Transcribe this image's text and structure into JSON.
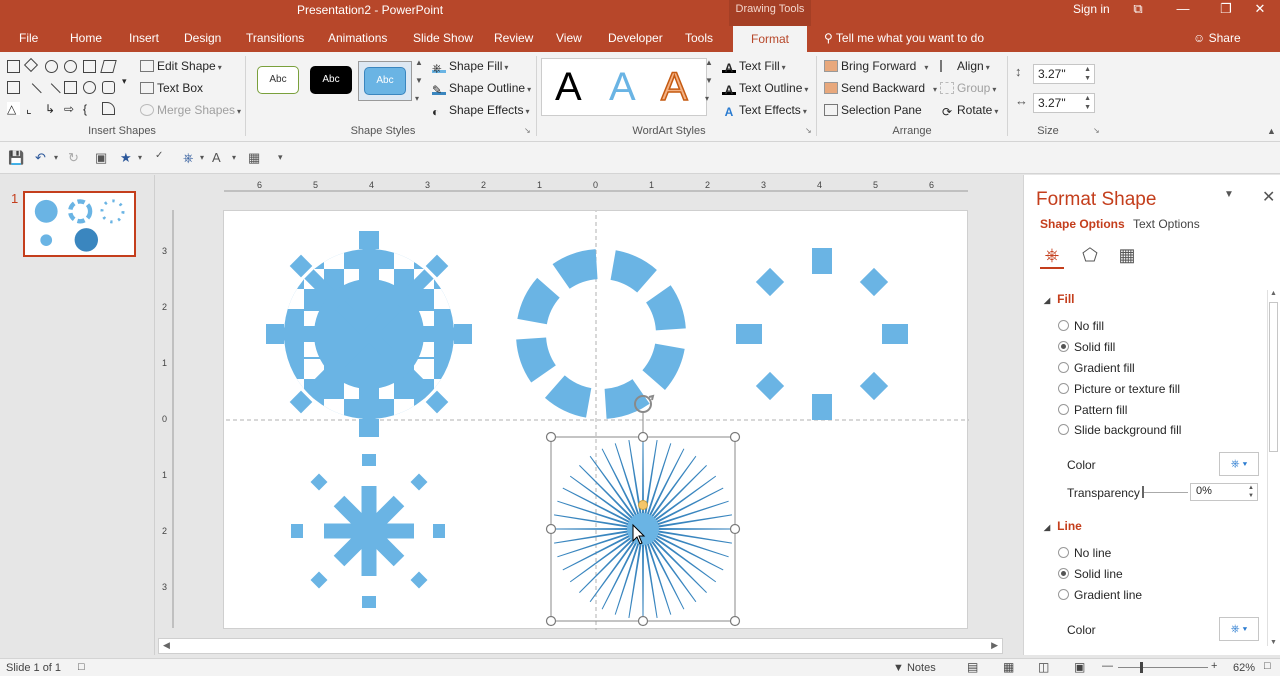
{
  "window": {
    "title": "Presentation2 - PowerPoint",
    "context_tab_group": "Drawing Tools",
    "sign_in": "Sign in",
    "controls": [
      "⧉",
      "—",
      "❐",
      "✕"
    ]
  },
  "tabs": [
    "File",
    "Home",
    "Insert",
    "Design",
    "Transitions",
    "Animations",
    "Slide Show",
    "Review",
    "View",
    "Developer",
    "Tools",
    "Format"
  ],
  "active_tab": "Format",
  "tell_me": "Tell me what you want to do",
  "share": "Share",
  "ribbon": {
    "insert_shapes": {
      "label": "Insert Shapes",
      "edit_shape": "Edit Shape",
      "text_box": "Text Box",
      "merge_shapes": "Merge Shapes"
    },
    "shape_styles": {
      "label": "Shape Styles",
      "presets": [
        "Abc",
        "Abc",
        "Abc"
      ],
      "shape_fill": "Shape Fill",
      "shape_outline": "Shape Outline",
      "shape_effects": "Shape Effects"
    },
    "wordart_styles": {
      "label": "WordArt Styles",
      "samples": [
        "A",
        "A",
        "A"
      ],
      "text_fill": "Text Fill",
      "text_outline": "Text Outline",
      "text_effects": "Text Effects"
    },
    "arrange": {
      "label": "Arrange",
      "bring_forward": "Bring Forward",
      "send_backward": "Send Backward",
      "selection_pane": "Selection Pane",
      "align": "Align",
      "group": "Group",
      "rotate": "Rotate"
    },
    "size": {
      "label": "Size",
      "height": "3.27\"",
      "width": "3.27\""
    }
  },
  "thumbnails": {
    "slide_number": "1"
  },
  "ruler": {
    "horizontal": [
      "6",
      "5",
      "4",
      "3",
      "2",
      "1",
      "0",
      "1",
      "2",
      "3",
      "4",
      "5",
      "6"
    ],
    "vertical": [
      "3",
      "2",
      "1",
      "0",
      "1",
      "2",
      "3"
    ]
  },
  "format_pane": {
    "title": "Format Shape",
    "shape_options": "Shape Options",
    "text_options": "Text Options",
    "fill": {
      "heading": "Fill",
      "options": [
        "No fill",
        "Solid fill",
        "Gradient fill",
        "Picture or texture fill",
        "Pattern fill",
        "Slide background fill"
      ],
      "selected": "Solid fill",
      "color_label": "Color",
      "transparency_label": "Transparency",
      "transparency_value": "0%"
    },
    "line": {
      "heading": "Line",
      "options": [
        "No line",
        "Solid line",
        "Gradient line"
      ],
      "selected": "Solid line",
      "color_label": "Color"
    }
  },
  "status": {
    "slide_info": "Slide 1 of 1",
    "notes": "Notes",
    "zoom": "62%"
  },
  "colors": {
    "accent": "#b7472a",
    "shape_fill": "#6ab4e4",
    "burst_line": "#3a86bf"
  }
}
